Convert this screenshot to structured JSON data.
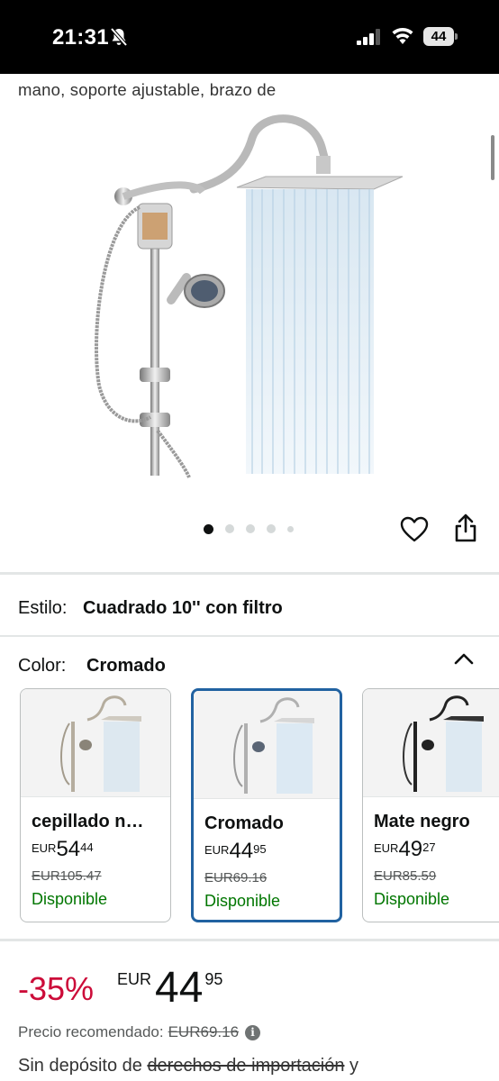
{
  "status_bar": {
    "time": "21:31",
    "battery": "44"
  },
  "product": {
    "title_fragment": "mano, soporte ajustable, brazo de",
    "image_icon": "rain-shower-head-with-filter-and-handheld",
    "carousel": {
      "count": 5,
      "active": 0
    }
  },
  "style_row": {
    "label": "Estilo:",
    "value": "Cuadrado 10'' con filtro"
  },
  "color_row": {
    "label": "Color:",
    "value": "Cromado"
  },
  "swatches": [
    {
      "name": "cepillado n…",
      "currency": "EUR",
      "price_int": "54",
      "price_dec": "44",
      "list_price": "EUR105.47",
      "availability": "Disponible",
      "finish": "brushed-nickel",
      "selected": false
    },
    {
      "name": "Cromado",
      "currency": "EUR",
      "price_int": "44",
      "price_dec": "95",
      "list_price": "EUR69.16",
      "availability": "Disponible",
      "finish": "chrome",
      "selected": true
    },
    {
      "name": "Mate negro",
      "currency": "EUR",
      "price_int": "49",
      "price_dec": "27",
      "list_price": "EUR85.59",
      "availability": "Disponible",
      "finish": "matte-black",
      "selected": false
    }
  ],
  "price": {
    "discount": "-35%",
    "currency": "EUR",
    "int": "44",
    "dec": "95",
    "recommended_label": "Precio recomendado:",
    "recommended_value": "EUR69.16"
  },
  "import_note": {
    "prefix": "Sin depósito de ",
    "struck": "derechos de importación",
    "suffix": " y"
  },
  "colors": {
    "discount": "#cc0c39",
    "available": "#007600",
    "selected_border": "#2162a1"
  }
}
